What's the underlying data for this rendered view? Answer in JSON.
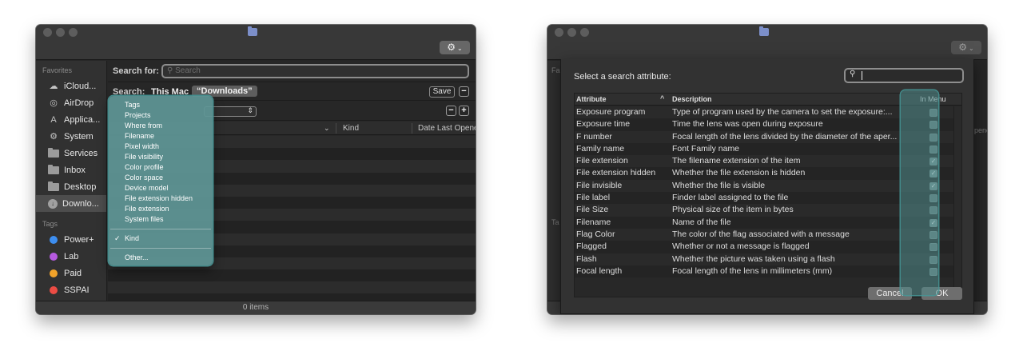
{
  "finder": {
    "gear_icon": "gear-icon",
    "sidebar": {
      "favorites_label": "Favorites",
      "favorites": [
        {
          "label": "iCloud...",
          "icon": "cloud-icon"
        },
        {
          "label": "AirDrop",
          "icon": "airdrop-icon"
        },
        {
          "label": "Applica...",
          "icon": "applications-icon"
        },
        {
          "label": "System",
          "icon": "gear-icon"
        },
        {
          "label": "Services",
          "icon": "folder-icon"
        },
        {
          "label": "Inbox",
          "icon": "folder-icon"
        },
        {
          "label": "Desktop",
          "icon": "desktop-icon"
        },
        {
          "label": "Downlo...",
          "icon": "downloads-icon",
          "selected": true
        }
      ],
      "tags_label": "Tags",
      "tags": [
        {
          "label": "Power+",
          "color": "#3d8ef0"
        },
        {
          "label": "Lab",
          "color": "#b65ae0"
        },
        {
          "label": "Paid",
          "color": "#f2a32a"
        },
        {
          "label": "SSPAI",
          "color": "#ec4c44"
        }
      ]
    },
    "search": {
      "label": "Search for:",
      "placeholder": "Search"
    },
    "scope": {
      "label": "Search:",
      "this_mac": "This Mac",
      "downloads": "“Downloads”",
      "save": "Save",
      "minus": "−",
      "plus": "+"
    },
    "columns": {
      "kind": "Kind",
      "date": "Date Last Opened"
    },
    "status": "0 items",
    "menu": {
      "items_a": [
        "Tags",
        "Projects",
        "Where from",
        "Filename",
        "Pixel width",
        "File visibility",
        "Color profile",
        "Color space",
        "Device model",
        "File extension hidden",
        "File extension",
        "System files"
      ],
      "checked": "Kind",
      "other": "Other..."
    }
  },
  "dialog": {
    "title": "Select a search attribute:",
    "headers": {
      "attribute": "Attribute",
      "sort_indicator": "^",
      "description": "Description",
      "in_menu": "In Menu"
    },
    "rows": [
      {
        "attribute": "Exposure program",
        "description": "Type of program used by the camera to set the exposure:...",
        "in_menu": false
      },
      {
        "attribute": "Exposure time",
        "description": "Time the lens was open during exposure",
        "in_menu": false
      },
      {
        "attribute": "F number",
        "description": "Focal length of the lens divided by the diameter of the aper...",
        "in_menu": false
      },
      {
        "attribute": "Family name",
        "description": "Font Family name",
        "in_menu": false
      },
      {
        "attribute": "File extension",
        "description": "The filename extension of the item",
        "in_menu": true
      },
      {
        "attribute": "File extension hidden",
        "description": "Whether the file extension is hidden",
        "in_menu": true
      },
      {
        "attribute": "File invisible",
        "description": "Whether the file is visible",
        "in_menu": true
      },
      {
        "attribute": "File label",
        "description": "Finder label assigned to the file",
        "in_menu": false
      },
      {
        "attribute": "File Size",
        "description": "Physical size of the item in bytes",
        "in_menu": false
      },
      {
        "attribute": "Filename",
        "description": "Name of the file",
        "in_menu": true
      },
      {
        "attribute": "Flag Color",
        "description": "The color of the flag associated with a message",
        "in_menu": false
      },
      {
        "attribute": "Flagged",
        "description": "Whether or not a message is flagged",
        "in_menu": false
      },
      {
        "attribute": "Flash",
        "description": "Whether the picture was taken using a flash",
        "in_menu": false
      },
      {
        "attribute": "Focal length",
        "description": "Focal length of the lens in millimeters (mm)",
        "in_menu": false
      }
    ],
    "cancel": "Cancel",
    "ok": "OK",
    "ghost_fav": "Fa",
    "ghost_tags": "Ta",
    "ghost_col": "pene"
  }
}
